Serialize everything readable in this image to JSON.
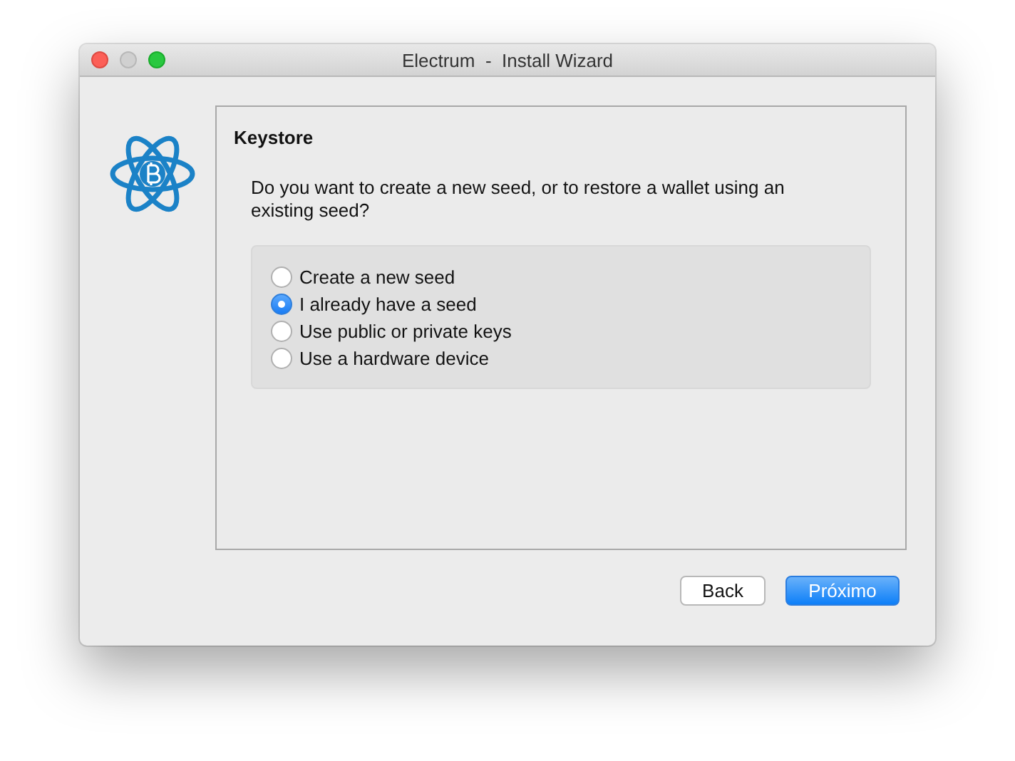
{
  "window": {
    "title": "Electrum  -  Install Wizard"
  },
  "page": {
    "heading": "Keystore",
    "question": "Do you want to create a new seed, or to restore a wallet using an existing seed?"
  },
  "options": [
    {
      "label": "Create a new seed",
      "selected": false
    },
    {
      "label": "I already have a seed",
      "selected": true
    },
    {
      "label": "Use public or private keys",
      "selected": false
    },
    {
      "label": "Use a hardware device",
      "selected": false
    }
  ],
  "buttons": [
    {
      "label": "Back",
      "kind": "secondary"
    },
    {
      "label": "Próximo",
      "kind": "primary"
    }
  ]
}
